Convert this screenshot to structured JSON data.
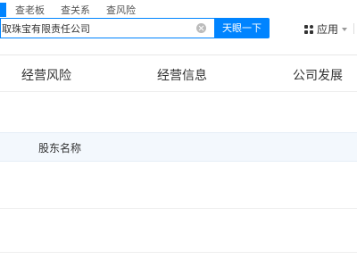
{
  "search_tabs": [
    "查老板",
    "查关系",
    "查风险"
  ],
  "search": {
    "value": "取珠宝有限责任公司",
    "button_label": "天眼一下"
  },
  "apps": {
    "label": "应用"
  },
  "nav": {
    "items": [
      "经营风险",
      "经营信息",
      "公司发展"
    ]
  },
  "table": {
    "headers": [
      "股东名称"
    ]
  },
  "colors": {
    "accent": "#0084ff",
    "table_header_bg": "#f3f8fd"
  },
  "icons": [
    "clear-icon",
    "apps-grid-icon",
    "caret-down-icon"
  ]
}
